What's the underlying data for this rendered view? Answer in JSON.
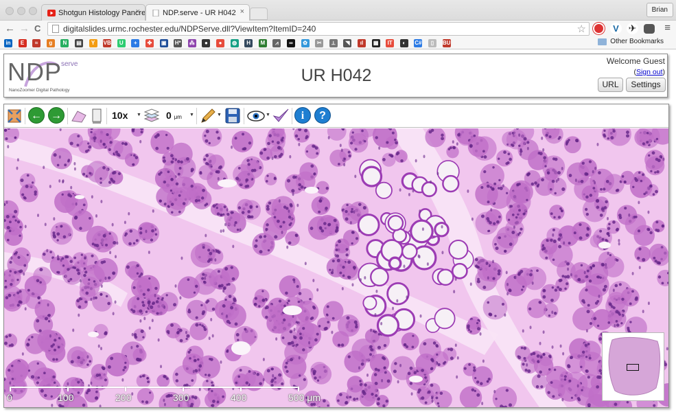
{
  "browser": {
    "tabs": [
      {
        "title": "Shotgun Histology Pancrea",
        "favicon": "youtube-icon",
        "close": "×"
      },
      {
        "title": "NDP.serve - UR H042",
        "favicon": "page-icon",
        "close": "×"
      }
    ],
    "profile_name": "Brian",
    "url": "digitalslides.urmc.rochester.edu/NDPServe.dll?ViewItem?ItemID=240",
    "nav": {
      "back": "←",
      "forward": "→",
      "reload": "C"
    },
    "bookmarks_bar": {
      "other_label": "Other Bookmarks",
      "icons": [
        "in",
        "E",
        "≈",
        "g",
        "N",
        "▤",
        "Y",
        "VB",
        "U",
        "+",
        "✤",
        "▣",
        "H*",
        "⁂",
        "●",
        "●",
        "◍",
        "H",
        "M",
        "⩘",
        "∞",
        "✿",
        "✂",
        "⟂",
        "◥",
        "ıl",
        "▦",
        "IT",
        "◐",
        "C#",
        "▯",
        "BU"
      ]
    }
  },
  "ndp": {
    "logo": {
      "text": "NDP",
      "superscript": "serve",
      "tagline": "NanoZoomer Digital Pathology"
    },
    "title": "UR H042",
    "welcome": "Welcome Guest",
    "signout_prefix": "(",
    "signout_link": "Sign out",
    "signout_suffix": ")",
    "buttons": {
      "url": "URL",
      "settings": "Settings"
    }
  },
  "toolbar": {
    "magnification": "10x",
    "focus_value": "0",
    "focus_unit": "μm"
  },
  "scalebar": {
    "labels": [
      "0",
      "100",
      "200",
      "300",
      "400",
      "500 μm"
    ]
  },
  "colors": {
    "tissue_background": "#f1c6ee",
    "nucleus": "#6a2a8c",
    "acinus": "#c06fc8",
    "mucous": "#f6f0f6",
    "help_blue": "#1e7ed1",
    "arrow_green": "#2e9a34"
  }
}
